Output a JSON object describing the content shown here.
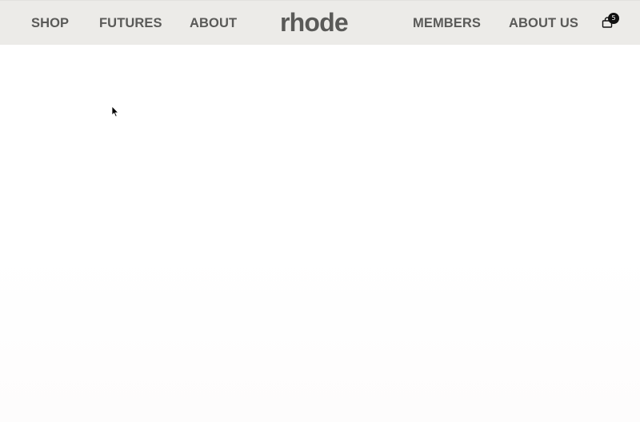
{
  "header": {
    "nav_left": [
      "SHOP",
      "FUTURES",
      "ABOUT"
    ],
    "logo": "rhode",
    "nav_right": [
      "MEMBERS",
      "ABOUT US"
    ],
    "cart": {
      "icon": "shopping-bag-icon",
      "count": "5"
    }
  },
  "colors": {
    "header_bg": "#ecebe8",
    "nav_text": "#5a5a58",
    "badge_bg": "#111111",
    "page_bg": "#ffffff"
  },
  "cursor": {
    "icon": "mouse-pointer-icon"
  }
}
